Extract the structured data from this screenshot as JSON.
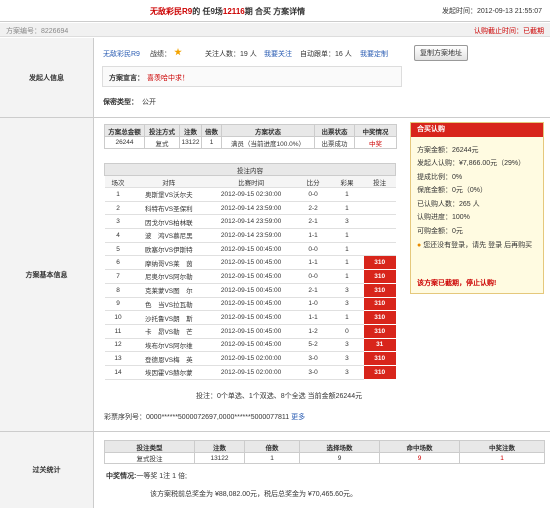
{
  "header": {
    "lottery": "无敌彩民R9",
    "title_mid1": "的 任9场",
    "issue": "12116",
    "title_mid2": "期 合买 方案详情",
    "publish_time": "发起时间：2012-09-13 21:55:07"
  },
  "idrow": {
    "label": "方案编号：",
    "number": "8226694",
    "deadline": "认购截止时间：已截期"
  },
  "initiator": {
    "section_label": "发起人信息",
    "username": "无敌彩民R9",
    "record_label": "战绩：",
    "followers_label": "关注人数：",
    "followers": "19 人",
    "follow_link": "我要关注",
    "auto_label": "自动跟单：",
    "auto_count": "16 人",
    "auto_link": "我要定制",
    "copy_button": "复制方案地址",
    "declaration_label": "方案宣言：",
    "declaration": "喜羡哈中求！",
    "privacy_label": "保密类型：",
    "privacy": "公开"
  },
  "plan": {
    "section_label": "方案基本信息",
    "info_headers": [
      "方案总金额",
      "投注方式",
      "注数",
      "倍数",
      "方案状态",
      "出票状态",
      "中奖情况"
    ],
    "info_values": [
      "26244",
      "复式",
      "13122",
      "1",
      "满员（当前进度100.0%）",
      "出票成功",
      "中奖"
    ],
    "match_caption": "投注内容",
    "match_headers": [
      "场次",
      "对阵",
      "比赛时间",
      "比分",
      "彩果",
      "投注"
    ],
    "matches": [
      [
        "1",
        "奥斯堡VS沃尔夫",
        "2012-09-15 02:30:00",
        "0-0",
        "1",
        ""
      ],
      [
        "2",
        "科特布VS圣保利",
        "2012-09-14 23:59:00",
        "2-2",
        "1",
        ""
      ],
      [
        "3",
        "因戈尔VS柏林联",
        "2012-09-14 23:59:00",
        "2-1",
        "3",
        ""
      ],
      [
        "4",
        "波　鸿VS慕尼黑",
        "2012-09-14 23:59:00",
        "1-1",
        "1",
        ""
      ],
      [
        "5",
        "欧塞尔VS伊斯特",
        "2012-09-15 00:45:00",
        "0-0",
        "1",
        ""
      ],
      [
        "6",
        "摩纳哥VS莱　茵",
        "2012-09-15 00:45:00",
        "1-1",
        "1",
        "310"
      ],
      [
        "7",
        "尼奥尔VS阿尔勒",
        "2012-09-15 00:45:00",
        "0-0",
        "1",
        "310"
      ],
      [
        "8",
        "克莱蒙VS图　尔",
        "2012-09-15 00:45:00",
        "2-1",
        "3",
        "310"
      ],
      [
        "9",
        "色　当VS拉瓦勒",
        "2012-09-15 00:45:00",
        "1-0",
        "3",
        "310"
      ],
      [
        "10",
        "沙托鲁VS朗　斯",
        "2012-09-15 00:45:00",
        "1-1",
        "1",
        "310"
      ],
      [
        "11",
        "卡　昂VS勒　芒",
        "2012-09-15 00:45:00",
        "1-2",
        "0",
        "310"
      ],
      [
        "12",
        "埃布尔VS阿尔维",
        "2012-09-15 00:45:00",
        "5-2",
        "3",
        "31"
      ],
      [
        "13",
        "登德恩VS梅　英",
        "2012-09-15 02:00:00",
        "3-0",
        "3",
        "310"
      ],
      [
        "14",
        "埃因霍VS赫尔蒙",
        "2012-09-15 02:00:00",
        "3-0",
        "3",
        "310"
      ]
    ],
    "summary": "投注：0个单选、1个双选、8个全选 当前金额26244元",
    "serial": "彩票序列号：0000******5000072697,0000******5000077811",
    "more": "更多"
  },
  "subscribe": {
    "title": "合买认购",
    "total": "方案金额：26244元",
    "initiator": "发起人认购：¥7,866.00元（29%）",
    "commission": "提成比例：0%",
    "guarantee": "保底金额：0元（0%）",
    "subscribers": "已认购人数：265 人",
    "progress": "认购进度：100%",
    "available": "可购金额：0元",
    "login_hint": "您还没有登录，请先 登录 后再购买",
    "closed": "该方案已截期，停止认购!"
  },
  "pass": {
    "section_label": "过关统计",
    "headers": [
      "投注类型",
      "注数",
      "倍数",
      "选择场数",
      "命中场数",
      "中奖注数"
    ],
    "row": [
      "复式投注",
      "13122",
      "1",
      "9",
      "9",
      "1"
    ],
    "win_label": "中奖情况:",
    "win_text": "一等奖 1注 1 倍;",
    "prize": "该方案税前总奖金为 ¥88,082.00元，税后总奖金为 ¥70,465.60元。"
  },
  "colors": {
    "accent": "#d8251b",
    "link": "#2a5cb3",
    "label_bg": "#f3f3f3"
  }
}
